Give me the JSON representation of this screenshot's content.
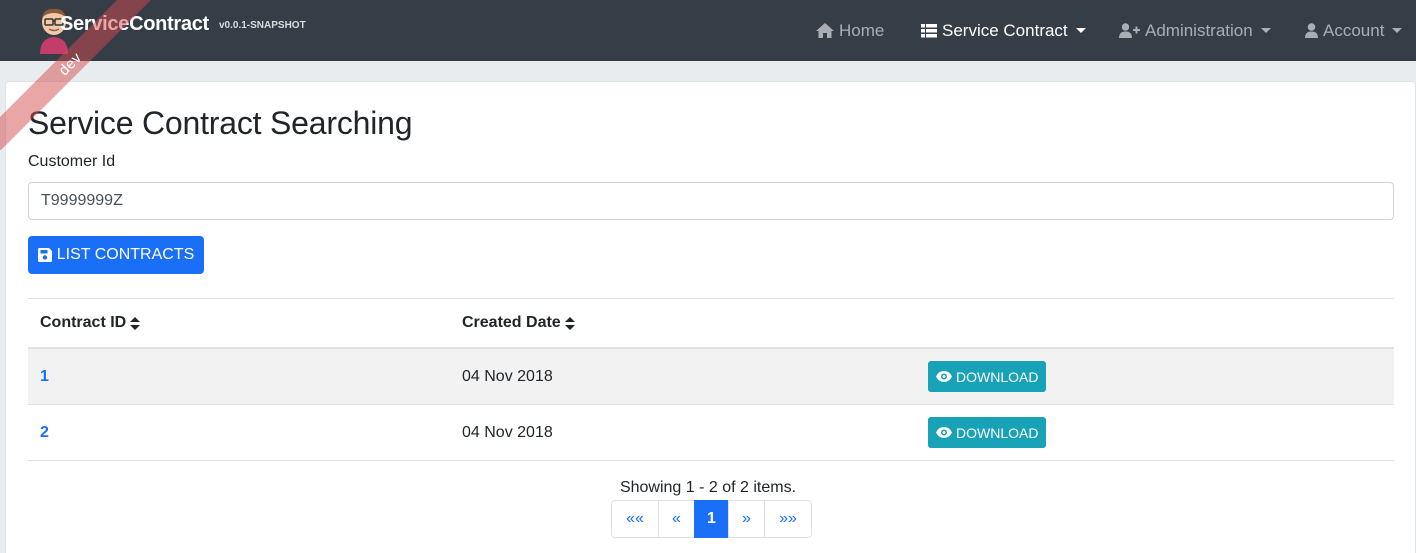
{
  "navbar": {
    "brand_title": "ServiceContract",
    "brand_version": "v0.0.1-SNAPSHOT",
    "ribbon": "dev",
    "items": [
      {
        "label": "Home",
        "icon": "home-icon",
        "active": false,
        "dropdown": false
      },
      {
        "label": "Service Contract",
        "icon": "table-icon",
        "active": true,
        "dropdown": true
      },
      {
        "label": "Administration",
        "icon": "user-plus-icon",
        "active": false,
        "dropdown": true
      },
      {
        "label": "Account",
        "icon": "user-icon",
        "active": false,
        "dropdown": true
      }
    ]
  },
  "main": {
    "title": "Service Contract Searching",
    "customer_id_label": "Customer Id",
    "customer_id_value": "T9999999Z",
    "list_button_label": "LIST CONTRACTS",
    "table": {
      "columns": [
        "Contract ID",
        "Created Date"
      ],
      "rows": [
        {
          "contract_id": "1",
          "created_date": "04 Nov 2018",
          "action": "DOWNLOAD"
        },
        {
          "contract_id": "2",
          "created_date": "04 Nov 2018",
          "action": "DOWNLOAD"
        }
      ]
    },
    "showing_text": "Showing 1 - 2 of 2 items.",
    "pagination": [
      "««",
      "«",
      "1",
      "»",
      "»»"
    ],
    "current_page": "1"
  },
  "colors": {
    "navbar_bg": "#353d47",
    "primary": "#1a6ff7",
    "info": "#17a2b8",
    "ribbon": "#d64c50"
  }
}
